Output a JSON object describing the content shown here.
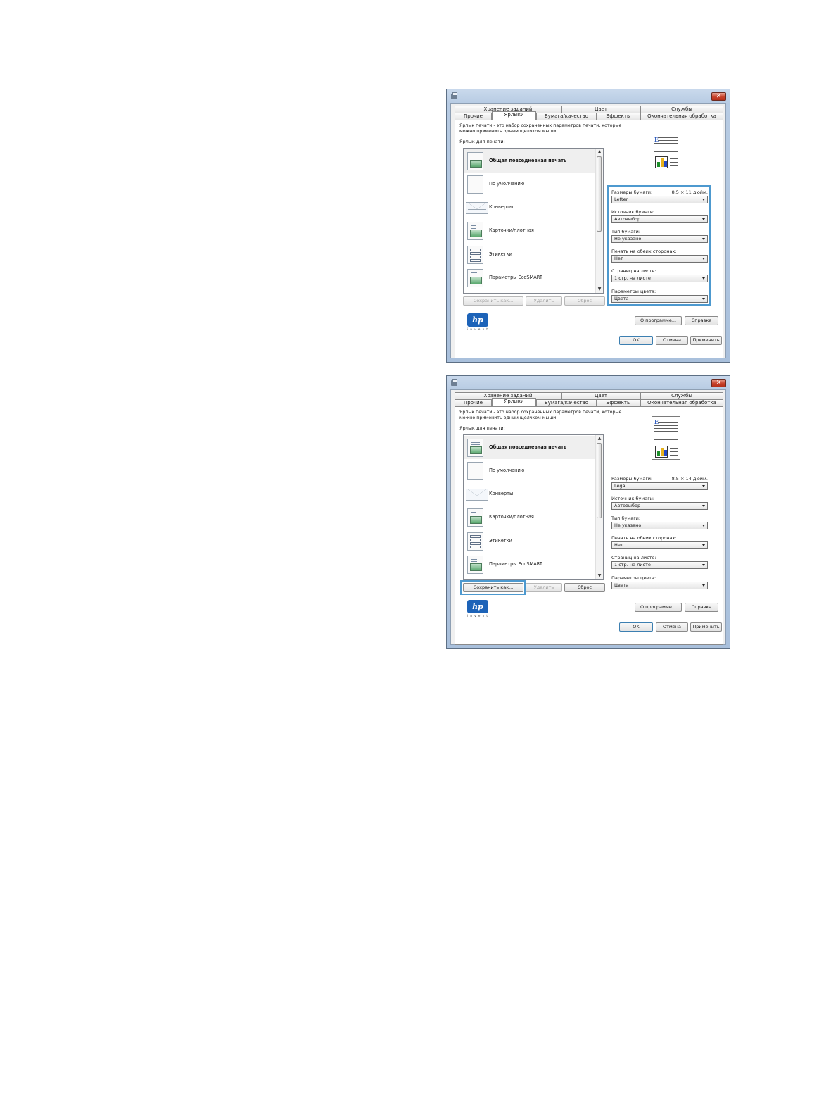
{
  "tabs_row1": [
    "Хранение заданий",
    "Цвет",
    "Службы"
  ],
  "tabs_row2": [
    "Прочие",
    "Ярлыки",
    "Бумага/качество",
    "Эффекты",
    "Окончательная обработка"
  ],
  "description": "Ярлык печати - это набор сохраненных параметров печати, которые можно применить одним щелчком мыши.",
  "list_label": "Ярлык для печати:",
  "shortcuts": [
    "Общая повседневная печать",
    "По умолчанию",
    "Конверты",
    "Карточки/плотная",
    "Этикетки",
    "Параметры EcoSMART"
  ],
  "list_buttons": {
    "save_as": "Сохранить как...",
    "delete": "Удалить",
    "reset": "Сброс"
  },
  "labels": {
    "paper_size": "Размеры бумаги:",
    "paper_source": "Источник бумаги:",
    "paper_type": "Тип бумаги:",
    "duplex": "Печать на обеих сторонах:",
    "pages_per_sheet": "Страниц на листе:",
    "color_options": "Параметры цвета:"
  },
  "bottom_buttons": {
    "about": "О программе...",
    "help": "Справка",
    "ok": "OK",
    "cancel": "Отмена",
    "apply": "Применить"
  },
  "hp_logo": "hp",
  "hp_tagline": "i n v e n t",
  "close_glyph": "✕",
  "scroll_up": "▲",
  "scroll_down": "▼",
  "accent_color": "#4d99cf",
  "dialogs": [
    {
      "paper_size_value": "8,5 × 11 дюйм.",
      "paper_size": "Letter",
      "paper_source": "Автовыбор",
      "paper_type": "Не указано",
      "duplex": "Нет",
      "pages_per_sheet": "1 стр. на листе",
      "color_options": "Цвета",
      "save_as_enabled": false,
      "highlight": "settings"
    },
    {
      "paper_size_value": "8,5 × 14 дюйм.",
      "paper_size": "Legal",
      "paper_source": "Автовыбор",
      "paper_type": "Не указано",
      "duplex": "Нет",
      "pages_per_sheet": "1 стр. на листе",
      "color_options": "Цвета",
      "save_as_enabled": true,
      "highlight": "save-as"
    }
  ]
}
